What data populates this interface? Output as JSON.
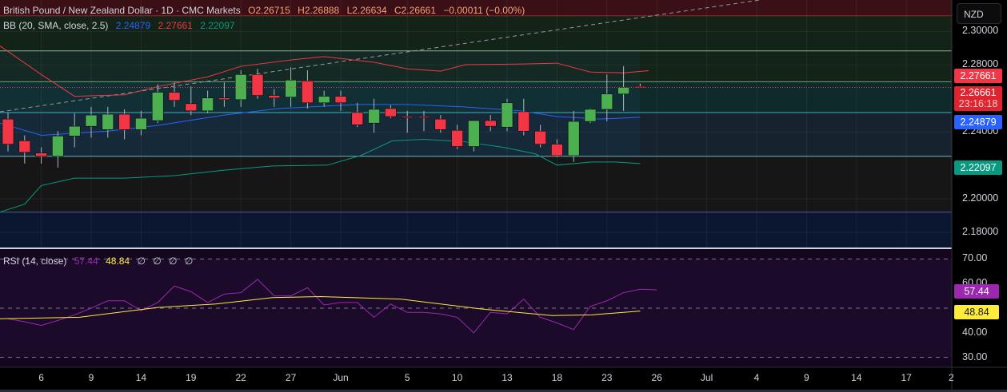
{
  "header": {
    "title": "British Pound / New Zealand Dollar · 1D · CMC Markets",
    "open": "O2.26715",
    "high": "H2.26888",
    "low": "L2.26634",
    "close": "C2.26661",
    "change": "−0.00011 (−0.00%)"
  },
  "bb_legend": {
    "label": "BB (20, SMA, close, 2.5)",
    "basis": "2.24879",
    "upper": "2.27661",
    "lower": "2.22097"
  },
  "rsi_legend": {
    "label": "RSI (14, close)",
    "rsi": "57.44",
    "ma": "48.84",
    "extra": [
      "∅",
      "∅",
      "∅",
      "∅"
    ]
  },
  "currency_button": "NZD",
  "price_tags": {
    "upper": "2.27661",
    "last": "2.26661",
    "countdown": "23:16:18",
    "basis": "2.24879",
    "lower": "2.22097"
  },
  "rsi_tags": {
    "rsi": "57.44",
    "ma": "48.84"
  },
  "colors": {
    "up": "#4caf50",
    "down": "#f23645",
    "upper": "#f23645",
    "basis": "#2962ff",
    "lower": "#089981",
    "rsi": "#9c27b0",
    "rsi_ma": "#ffeb3b"
  },
  "chart_data": [
    {
      "type": "candlestick",
      "title": "British Pound / New Zealand Dollar · 1D · CMC Markets",
      "ylim": [
        2.171,
        2.3188
      ],
      "yticks": [
        "2.30000",
        "2.28000",
        "2.24000",
        "2.20000",
        "2.18000"
      ],
      "ytick_values": [
        2.3,
        2.28,
        2.24,
        2.2,
        2.18
      ],
      "xticks": [
        {
          "label": "6",
          "i": 2
        },
        {
          "label": "9",
          "i": 5
        },
        {
          "label": "14",
          "i": 8
        },
        {
          "label": "19",
          "i": 11
        },
        {
          "label": "22",
          "i": 14
        },
        {
          "label": "27",
          "i": 17
        },
        {
          "label": "Jun",
          "i": 20
        },
        {
          "label": "5",
          "i": 24
        },
        {
          "label": "10",
          "i": 27
        },
        {
          "label": "13",
          "i": 30
        },
        {
          "label": "18",
          "i": 33
        },
        {
          "label": "23",
          "i": 36
        },
        {
          "label": "26",
          "i": 39
        },
        {
          "label": "Jul",
          "i": 42
        },
        {
          "label": "4",
          "i": 45
        },
        {
          "label": "9",
          "i": 48
        },
        {
          "label": "14",
          "i": 51
        },
        {
          "label": "17",
          "i": 54
        },
        {
          "label": "2",
          "i": 56.7
        }
      ],
      "candles": [
        [
          2.2477,
          2.2516,
          2.2284,
          2.2327
        ],
        [
          2.2347,
          2.238,
          2.2211,
          2.2279
        ],
        [
          2.2274,
          2.2308,
          2.2211,
          2.2255
        ],
        [
          2.2255,
          2.2405,
          2.2187,
          2.2376
        ],
        [
          2.2376,
          2.2511,
          2.2308,
          2.2434
        ],
        [
          2.2434,
          2.255,
          2.2366,
          2.2501
        ],
        [
          2.2414,
          2.255,
          2.2366,
          2.2506
        ],
        [
          2.2506,
          2.2535,
          2.2356,
          2.2414
        ],
        [
          2.2414,
          2.2526,
          2.238,
          2.2482
        ],
        [
          2.2468,
          2.2685,
          2.2453,
          2.2637
        ],
        [
          2.2637,
          2.2695,
          2.255,
          2.2589
        ],
        [
          2.2569,
          2.2671,
          2.2501,
          2.2526
        ],
        [
          2.2526,
          2.2647,
          2.2511,
          2.2603
        ],
        [
          2.2603,
          2.2695,
          2.255,
          2.2593
        ],
        [
          2.2593,
          2.2768,
          2.255,
          2.2743
        ],
        [
          2.2743,
          2.2777,
          2.2598,
          2.2618
        ],
        [
          2.2618,
          2.2656,
          2.255,
          2.2603
        ],
        [
          2.2608,
          2.2787,
          2.255,
          2.271
        ],
        [
          2.2705,
          2.2768,
          2.254,
          2.2574
        ],
        [
          2.2574,
          2.2647,
          2.255,
          2.2613
        ],
        [
          2.2613,
          2.2647,
          2.2526,
          2.2574
        ],
        [
          2.2516,
          2.2574,
          2.2429,
          2.2443
        ],
        [
          2.2453,
          2.2598,
          2.2395,
          2.2535
        ],
        [
          2.254,
          2.256,
          2.2482,
          2.2492
        ],
        [
          2.2492,
          2.2526,
          2.2395,
          2.249
        ],
        [
          2.2492,
          2.2526,
          2.2405,
          2.2487
        ],
        [
          2.2477,
          2.2501,
          2.2395,
          2.2414
        ],
        [
          2.241,
          2.2443,
          2.2298,
          2.2313
        ],
        [
          2.2313,
          2.2468,
          2.2284,
          2.2468
        ],
        [
          2.2468,
          2.2501,
          2.2405,
          2.2434
        ],
        [
          2.2429,
          2.2598,
          2.2405,
          2.2574
        ],
        [
          2.2521,
          2.2598,
          2.238,
          2.2405
        ],
        [
          2.2405,
          2.2443,
          2.2308,
          2.2327
        ],
        [
          2.2327,
          2.2356,
          2.225,
          2.2259
        ],
        [
          2.2259,
          2.2526,
          2.2221,
          2.2463
        ],
        [
          2.2463,
          2.254,
          2.2453,
          2.2535
        ],
        [
          2.2535,
          2.2743,
          2.2463,
          2.2627
        ],
        [
          2.2627,
          2.2792,
          2.2526,
          2.2666
        ],
        [
          2.26715,
          2.26888,
          2.26634,
          2.26661
        ]
      ],
      "series": [
        {
          "name": "BB upper",
          "points": [
            [
              -0.5,
              2.2915
            ],
            [
              2,
              2.2743
            ],
            [
              4,
              2.2613
            ],
            [
              7,
              2.2622
            ],
            [
              9,
              2.2671
            ],
            [
              12,
              2.2729
            ],
            [
              14,
              2.2792
            ],
            [
              17,
              2.283
            ],
            [
              19,
              2.285
            ],
            [
              22,
              2.2816
            ],
            [
              24,
              2.2777
            ],
            [
              26,
              2.2763
            ],
            [
              27.5,
              2.2802
            ],
            [
              31,
              2.2806
            ],
            [
              33,
              2.2811
            ],
            [
              35,
              2.2758
            ],
            [
              37,
              2.2753
            ],
            [
              38.5,
              2.2766
            ]
          ]
        },
        {
          "name": "BB basis",
          "points": [
            [
              -0.5,
              2.2453
            ],
            [
              2,
              2.238
            ],
            [
              6,
              2.2405
            ],
            [
              9,
              2.2439
            ],
            [
              13,
              2.2501
            ],
            [
              16.3,
              2.254
            ],
            [
              21,
              2.2564
            ],
            [
              24,
              2.2564
            ],
            [
              27.4,
              2.255
            ],
            [
              30.8,
              2.2526
            ],
            [
              33,
              2.2492
            ],
            [
              35.6,
              2.2477
            ],
            [
              38,
              2.2488
            ]
          ]
        },
        {
          "name": "BB lower",
          "points": [
            [
              -0.5,
              2.1921
            ],
            [
              1,
              2.1969
            ],
            [
              2,
              2.208
            ],
            [
              4,
              2.2124
            ],
            [
              7,
              2.2124
            ],
            [
              10,
              2.2139
            ],
            [
              13,
              2.2172
            ],
            [
              15.9,
              2.2197
            ],
            [
              19.2,
              2.2202
            ],
            [
              21.2,
              2.2259
            ],
            [
              23.1,
              2.2347
            ],
            [
              25,
              2.2356
            ],
            [
              27.4,
              2.2342
            ],
            [
              29.8,
              2.2308
            ],
            [
              31.7,
              2.2269
            ],
            [
              33,
              2.2202
            ],
            [
              35.1,
              2.2221
            ],
            [
              36.5,
              2.2221
            ],
            [
              38,
              2.2211
            ]
          ]
        }
      ],
      "levels": [
        2.3094,
        2.2884,
        2.27,
        2.2516,
        2.2255,
        2.1921
      ]
    },
    {
      "type": "line",
      "title": "RSI (14, close)",
      "ylim": [
        26,
        74
      ],
      "yticks": [
        "70.00",
        "60.00",
        "40.00",
        "30.00"
      ],
      "ytick_values": [
        70,
        60,
        40,
        30
      ],
      "guides": [
        70,
        50,
        30
      ],
      "series": [
        {
          "name": "RSI",
          "values": [
            45.7,
            44.5,
            43,
            45,
            47.3,
            50,
            53,
            53,
            49,
            52.3,
            59,
            56.7,
            52.3,
            55.7,
            56.3,
            61.7,
            55,
            55,
            58.3,
            51.3,
            52.3,
            52.3,
            46.3,
            51.7,
            48.3,
            48.3,
            47.7,
            46.3,
            40,
            48.3,
            47.7,
            53.7,
            46.3,
            44,
            41.3,
            50.7,
            53,
            56.3,
            57.7,
            57.44
          ]
        },
        {
          "name": "RSI-based MA",
          "points": [
            [
              -0.5,
              45.7
            ],
            [
              4.3,
              46.3
            ],
            [
              9,
              50.3
            ],
            [
              12.5,
              51.7
            ],
            [
              15.9,
              54.3
            ],
            [
              18.8,
              54.7
            ],
            [
              23.6,
              53.7
            ],
            [
              28.4,
              49.7
            ],
            [
              32.7,
              47
            ],
            [
              35.1,
              47.3
            ],
            [
              38,
              48.84
            ]
          ]
        }
      ]
    }
  ]
}
